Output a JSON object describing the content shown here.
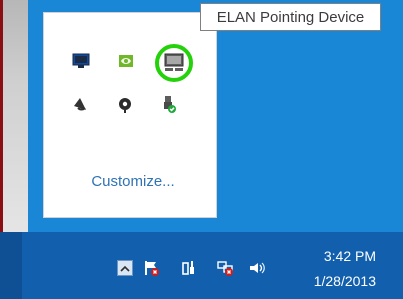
{
  "tooltip": {
    "text": "ELAN Pointing Device"
  },
  "tray": {
    "customize_label": "Customize...",
    "icons": [
      {
        "name": "monitor-icon"
      },
      {
        "name": "nvidia-icon"
      },
      {
        "name": "elan-touchpad-icon",
        "highlighted": true
      },
      {
        "name": "speakerphone-icon"
      },
      {
        "name": "webcam-icon"
      },
      {
        "name": "usb-safely-remove-icon"
      }
    ]
  },
  "taskbar": {
    "icons": [
      {
        "name": "show-hidden-icons-icon"
      },
      {
        "name": "action-center-icon"
      },
      {
        "name": "power-icon"
      },
      {
        "name": "network-icon"
      },
      {
        "name": "volume-icon"
      }
    ],
    "time": "3:42 PM",
    "date": "1/28/2013"
  },
  "colors": {
    "desktop": "#1a86d6",
    "taskbar": "#1260ad",
    "highlight_ring": "#24d10a",
    "link": "#2f73b5"
  }
}
